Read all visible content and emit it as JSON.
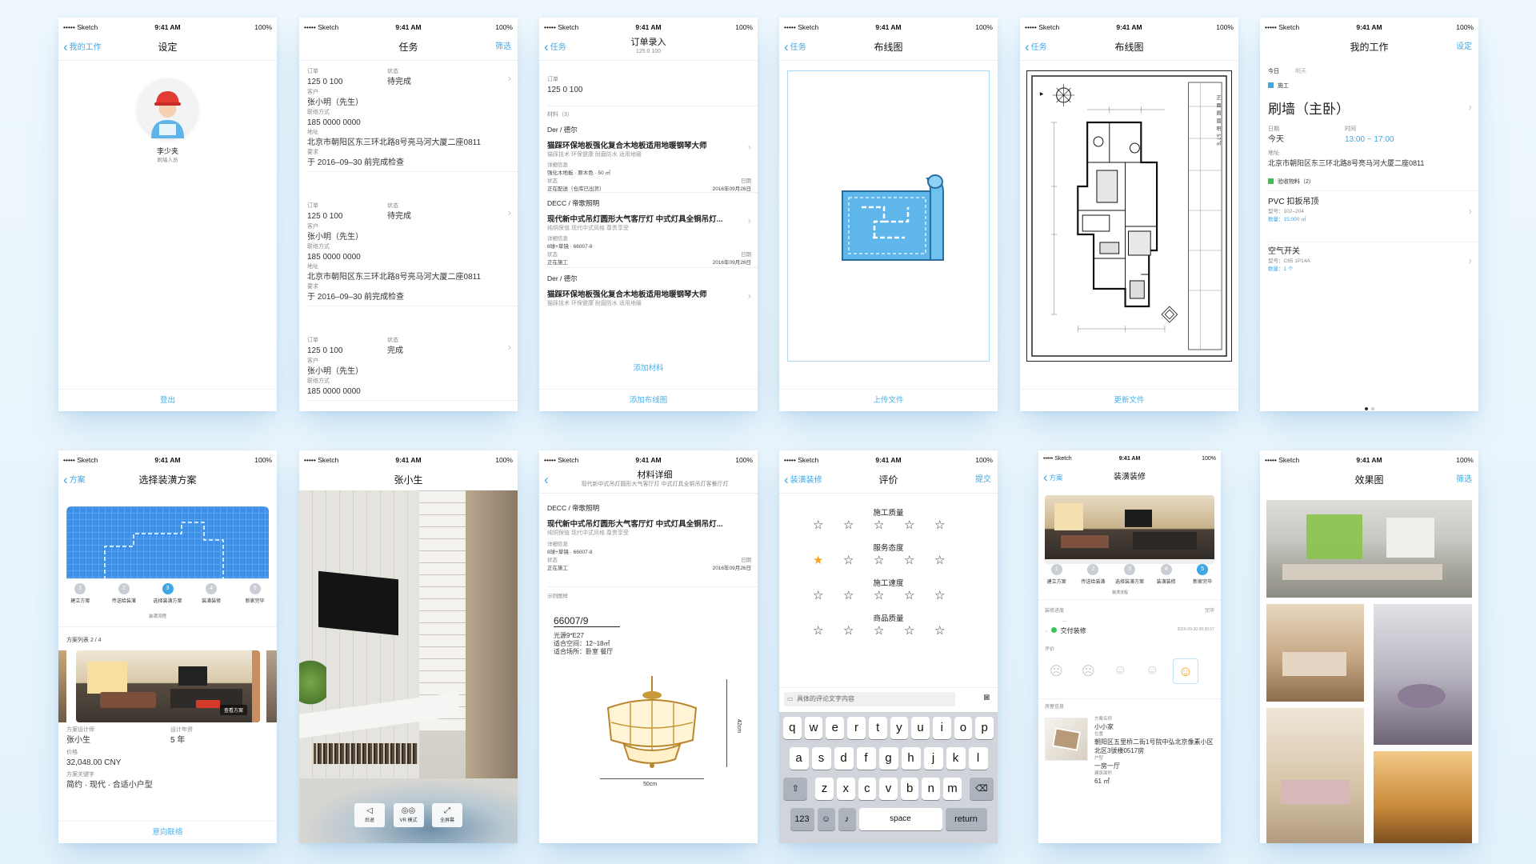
{
  "status": {
    "carrier": "••••• Sketch",
    "time": "9:41 AM",
    "battery": "100%",
    "wifi": "wifi-icon"
  },
  "colors": {
    "accent": "#3ea7e6",
    "star": "#f5a623",
    "bg": "#eaf5fc"
  },
  "s1": {
    "back": "我的工作",
    "title": "设定",
    "name": "李少夹",
    "role": "刷墙人员",
    "logout": "登出"
  },
  "s2": {
    "title": "任务",
    "right": "筛选",
    "labels": {
      "order": "订单",
      "status": "状态",
      "customer": "客户",
      "contact": "联络方式",
      "address": "地址",
      "request": "要求"
    },
    "tasks": [
      {
        "order": "125 0 100",
        "status": "待完成",
        "customer": "张小明（先生）",
        "contact": "185 0000 0000",
        "address": "北京市朝阳区东三环北路8号亮马河大厦二座0811",
        "request": "于 2016–09–30 前完成检查"
      },
      {
        "order": "125 0 100",
        "status": "待完成",
        "customer": "张小明（先生）",
        "contact": "185 0000 0000",
        "address": "北京市朝阳区东三环北路8号亮马河大厦二座0811",
        "request": "于 2016–09–30 前完成检查"
      },
      {
        "order": "125 0 100",
        "status": "完成",
        "customer": "张小明（先生）",
        "contact": "185 0000 0000"
      }
    ]
  },
  "s3": {
    "back": "任务",
    "title": "订单录入",
    "subtitle": "125 0 100",
    "order_label": "订单",
    "order": "125 0 100",
    "materials_label": "材料（3）",
    "groups": [
      {
        "brand": "Der / 德尔",
        "name": "猫踩环保地板强化复合木地板适用地暖钢琴大师",
        "desc": "猫踩技术 环保健康 耐磨防水 适用地暖",
        "info_label": "详细信息",
        "info": "强化木地板 · 原木色 · 50 ㎡",
        "state_label": "状态",
        "state": "正在配送（仓库已出货）",
        "date_label": "日期",
        "date": "2016年09月26日"
      },
      {
        "brand": "DECC / 帝歌照明",
        "name": "现代新中式吊灯圆形大气客厅灯 中式灯具全铜吊灯...",
        "desc": "纯铜保值 现代中式风格 尊贵享受",
        "info_label": "详细信息",
        "info": "8球+草镜 · 66007-8",
        "state_label": "状态",
        "state": "正在施工",
        "date_label": "日期",
        "date": "2016年09月26日"
      },
      {
        "brand": "Der / 德尔",
        "name": "猫踩环保地板强化复合木地板适用地暖钢琴大师",
        "desc": "猫踩技术 环保健康 耐磨防水 适用地暖"
      }
    ],
    "add_material": "添加材料",
    "add_layout": "添加布线图"
  },
  "s4": {
    "back": "任务",
    "title": "布线图",
    "upload": "上传文件"
  },
  "s5": {
    "back": "任务",
    "title": "布线图",
    "update": "更新文件",
    "side_text": "正 面 图 面 积 57㎡"
  },
  "s6": {
    "title": "我的工作",
    "right": "设定",
    "tab_today": "今日",
    "tab_tomorrow": "明天",
    "category": "施工",
    "job": "刷墙（主卧）",
    "date_label": "日期",
    "date": "今天",
    "time_label": "时间",
    "time": "13:00 ~ 17:00",
    "addr_label": "地址",
    "address": "北京市朝阳区东三环北路8号亮马河大厦二座0811",
    "mat_label": "验收物料（2）",
    "items": [
      {
        "name": "PVC 扣扳吊顶",
        "model": "型号：102–204",
        "qty": "数量：15,000 ㎡"
      },
      {
        "name": "空气开关",
        "model": "型号：C65 1P14A",
        "qty": "数量：1 个"
      }
    ]
  },
  "s7": {
    "back": "方案",
    "title": "选择装潢方案",
    "steps": [
      "建立方案",
      "传送给装潢",
      "选择装潢方案",
      "装潢装修",
      "新家完毕"
    ],
    "step_sub": "装潢流程",
    "list_label": "方案列表 2 / 4",
    "view": "查看方案",
    "designer_label": "方案设计师",
    "designer": "张小生",
    "years_label": "设计年资",
    "years": "5 年",
    "price_label": "价格",
    "price": "32,048.00 CNY",
    "kw_label": "方案关键字",
    "keywords": "简约 · 现代 · 合适小户型",
    "contact": "意向联络"
  },
  "s8": {
    "title": "张小生",
    "btns": [
      "后退",
      "VR 模式",
      "全屏幕"
    ]
  },
  "s9": {
    "title": "材料详细",
    "subtitle": "现代新中式吊灯圆形大气客厅灯 中式灯具全铜吊灯客餐厅灯",
    "brand": "DECC / 帝歌照明",
    "name": "现代新中式吊灯圆形大气客厅灯 中式灯具全铜吊灯...",
    "desc": "纯铜保值 现代中式风格 尊贵享受",
    "info_label": "详细信息",
    "info": "8球+草镜 · 66007-8",
    "state_label": "状态",
    "state": "正在施工",
    "date_label": "日期",
    "date": "2016年09月26日",
    "sample_label": "示例图样",
    "model": "66007/9",
    "spec1": "光源9*E27",
    "spec2": "适合空间：12~18㎡",
    "spec3": "适合场所：卧室 餐厅",
    "height": "42cm",
    "width": "50cm"
  },
  "s10": {
    "back": "装潢装修",
    "title": "评价",
    "right": "提交",
    "cats": [
      {
        "name": "施工质量",
        "rating": 0
      },
      {
        "name": "服务态度",
        "rating": 1
      },
      {
        "name": "施工速度",
        "rating": 0
      },
      {
        "name": "商品质量",
        "rating": 0
      }
    ],
    "placeholder": "具体的评论文字内容",
    "keys": {
      "row1": [
        "q",
        "w",
        "e",
        "r",
        "t",
        "y",
        "u",
        "i",
        "o",
        "p"
      ],
      "row2": [
        "a",
        "s",
        "d",
        "f",
        "g",
        "h",
        "j",
        "k",
        "l"
      ],
      "row3": [
        "z",
        "x",
        "c",
        "v",
        "b",
        "n",
        "m"
      ],
      "num": "123",
      "space": "space",
      "ret": "return"
    }
  },
  "s11": {
    "back": "方案",
    "title": "装潢装修",
    "steps": [
      "建立方案",
      "传送给装潢",
      "选择装潢方案",
      "装潢装修",
      "新家完毕"
    ],
    "step_sub": "装潢流程",
    "progress_label": "装修进度",
    "progress_done": "完毕",
    "dots": "...",
    "step_done": "交付装修",
    "step_date": "2016-09-30 09:30:07",
    "rate_label": "评价",
    "info_label": "房屋信息",
    "plan_label": "方案名称",
    "plan": "小小家",
    "loc_label": "位置",
    "location": "朝阳区五里桥二街1号院中弘北京像素小区北区3號楼0517房",
    "type_label": "户型",
    "type": "一房一厅",
    "area_label": "建筑面积",
    "area": "61 ㎡"
  },
  "s12": {
    "title": "效果图",
    "right": "筛选"
  }
}
